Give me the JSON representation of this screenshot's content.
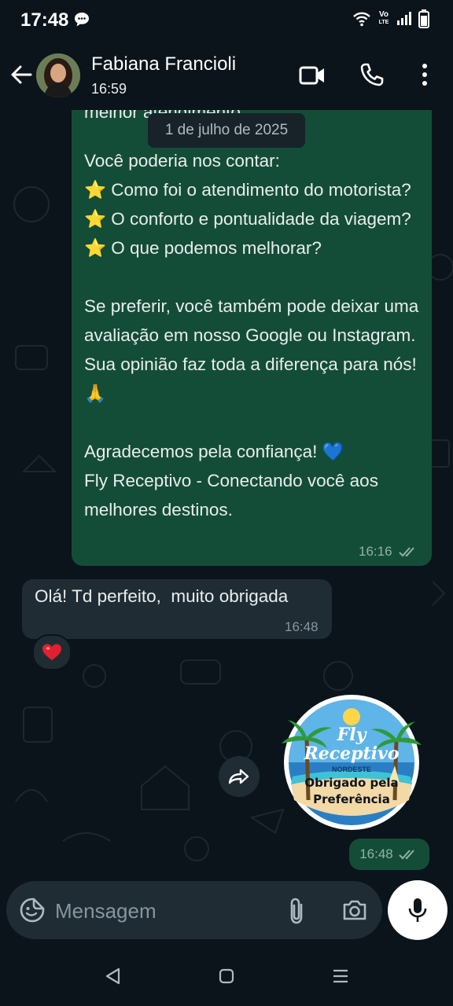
{
  "status_bar": {
    "time": "17:48",
    "volte_top": "Vo",
    "volte_bottom": "LTE"
  },
  "header": {
    "contact_name": "Fabiana Francioli",
    "last_seen": "16:59"
  },
  "chat": {
    "partial_line": "melhor atendimento",
    "date_chip": "1 de julho de 2025",
    "outgoing_message": {
      "text": "Você poderia nos contar:\n⭐ Como foi o atendimento do motorista?\n⭐ O conforto e pontualidade da viagem?\n⭐ O que podemos melhorar?\n\nSe preferir, você também pode deixar uma avaliação em nosso Google ou Instagram. Sua opinião faz toda a diferença para nós! 🙏\n\nAgradecemos pela confiança! 💙\nFly Receptivo - Conectando você aos melhores destinos.",
      "time": "16:16"
    },
    "incoming_message": {
      "text": "Olá! Td perfeito,  muito obrigada",
      "time": "16:48",
      "reaction": "❤️"
    },
    "sticker": {
      "logo_line1": "Fly",
      "logo_line2": "Receptivo",
      "logo_sub": "NORDESTE",
      "caption": "Obrigado pela Preferência",
      "time": "16:48"
    }
  },
  "composer": {
    "placeholder": "Mensagem"
  },
  "colors": {
    "background": "#0b141a",
    "outgoing_bubble": "#144d37",
    "incoming_bubble": "#202c33",
    "read_ticks": "#8fb3a5"
  },
  "icons": [
    "chat-bubble-icon",
    "wifi-icon",
    "signal-icon",
    "battery-icon",
    "back-arrow-icon",
    "video-call-icon",
    "phone-icon",
    "more-options-icon",
    "double-check-icon",
    "heart-icon",
    "forward-icon",
    "sticker-icon",
    "attach-icon",
    "camera-icon",
    "mic-icon",
    "nav-back-icon",
    "nav-home-icon",
    "nav-recents-icon"
  ]
}
